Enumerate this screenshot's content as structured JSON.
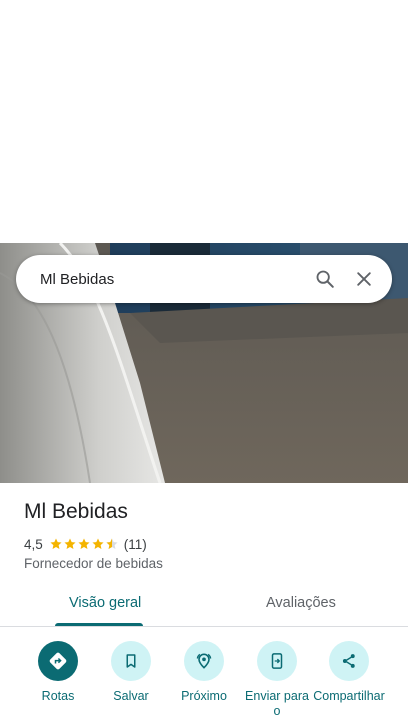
{
  "search": {
    "query": "Ml Bebidas"
  },
  "place": {
    "name": "Ml Bebidas",
    "rating": "4,5",
    "rating_value": 4.5,
    "rating_max": 5,
    "review_count": "(11)",
    "category": "Fornecedor de bebidas"
  },
  "tabs": [
    {
      "label": "Visão geral",
      "selected": true
    },
    {
      "label": "Avaliações",
      "selected": false
    }
  ],
  "actions": [
    {
      "label": "Rotas",
      "icon": "directions-icon"
    },
    {
      "label": "Salvar",
      "icon": "bookmark-icon"
    },
    {
      "label": "Próximo",
      "icon": "nearby-icon"
    },
    {
      "label": "Enviar para o",
      "icon": "send-to-phone-icon"
    },
    {
      "label": "Compartilhar",
      "icon": "share-icon"
    }
  ],
  "colors": {
    "accent": "#0b6b73",
    "action_bg": "#cff3f5",
    "star": "#f4b400"
  }
}
